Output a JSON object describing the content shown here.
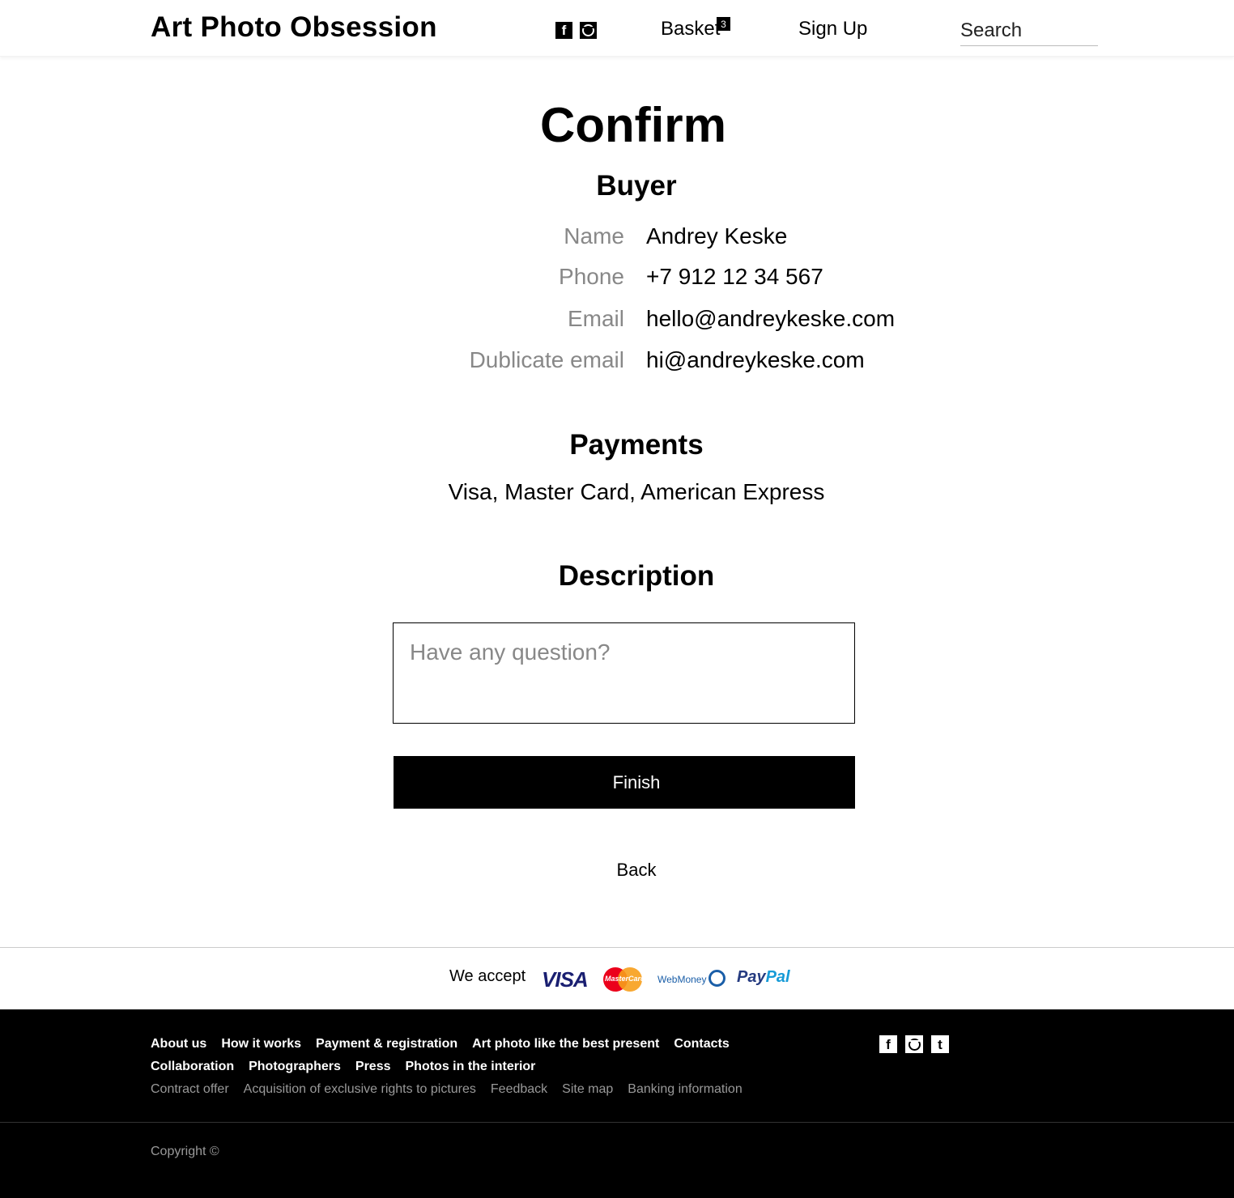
{
  "header": {
    "logo": "Art Photo Obsession",
    "social": [
      {
        "icon": "facebook-icon",
        "glyph": "f"
      },
      {
        "icon": "instagram-icon",
        "glyph": ""
      }
    ],
    "basket_label": "Basket",
    "basket_count": "3",
    "signup_label": "Sign Up",
    "search_placeholder": "Search"
  },
  "main": {
    "title": "Confirm",
    "buyer": {
      "heading": "Buyer",
      "fields": [
        {
          "label": "Name",
          "value": "Andrey Keske"
        },
        {
          "label": "Phone",
          "value": "+7 912 12 34 567"
        },
        {
          "label": "Email",
          "value": "hello@andreykeske.com"
        },
        {
          "label": "Dublicate email",
          "value": "hi@andreykeske.com"
        }
      ]
    },
    "payments": {
      "heading": "Payments",
      "text": "Visa, Master Card, American Express"
    },
    "description": {
      "heading": "Description",
      "placeholder": "Have any question?"
    },
    "finish_label": "Finish",
    "back_label": "Back"
  },
  "accept": {
    "label": "We accept",
    "logos": {
      "visa": "VISA",
      "mastercard": "MasterCard",
      "webmoney": "WebMoney",
      "paypal_a": "Pay",
      "paypal_b": "Pal"
    }
  },
  "footer": {
    "row1": [
      "About us",
      "How it works",
      "Payment & registration",
      "Art photo like the best present",
      "Contacts"
    ],
    "row2": [
      "Collaboration",
      "Photographers",
      "Press",
      "Photos in the interior"
    ],
    "row3": [
      "Contract offer",
      "Acquisition of exclusive rights to pictures",
      "Feedback",
      "Site map",
      "Banking information"
    ],
    "social": [
      {
        "icon": "facebook-icon",
        "glyph": "f"
      },
      {
        "icon": "instagram-icon",
        "glyph": ""
      },
      {
        "icon": "tumblr-icon",
        "glyph": "t"
      }
    ],
    "copyright": "Copyright ©"
  },
  "colors": {
    "accent": "#000000",
    "muted_label": "#888888",
    "footer_bg": "#000000",
    "footer_muted": "#999999"
  }
}
